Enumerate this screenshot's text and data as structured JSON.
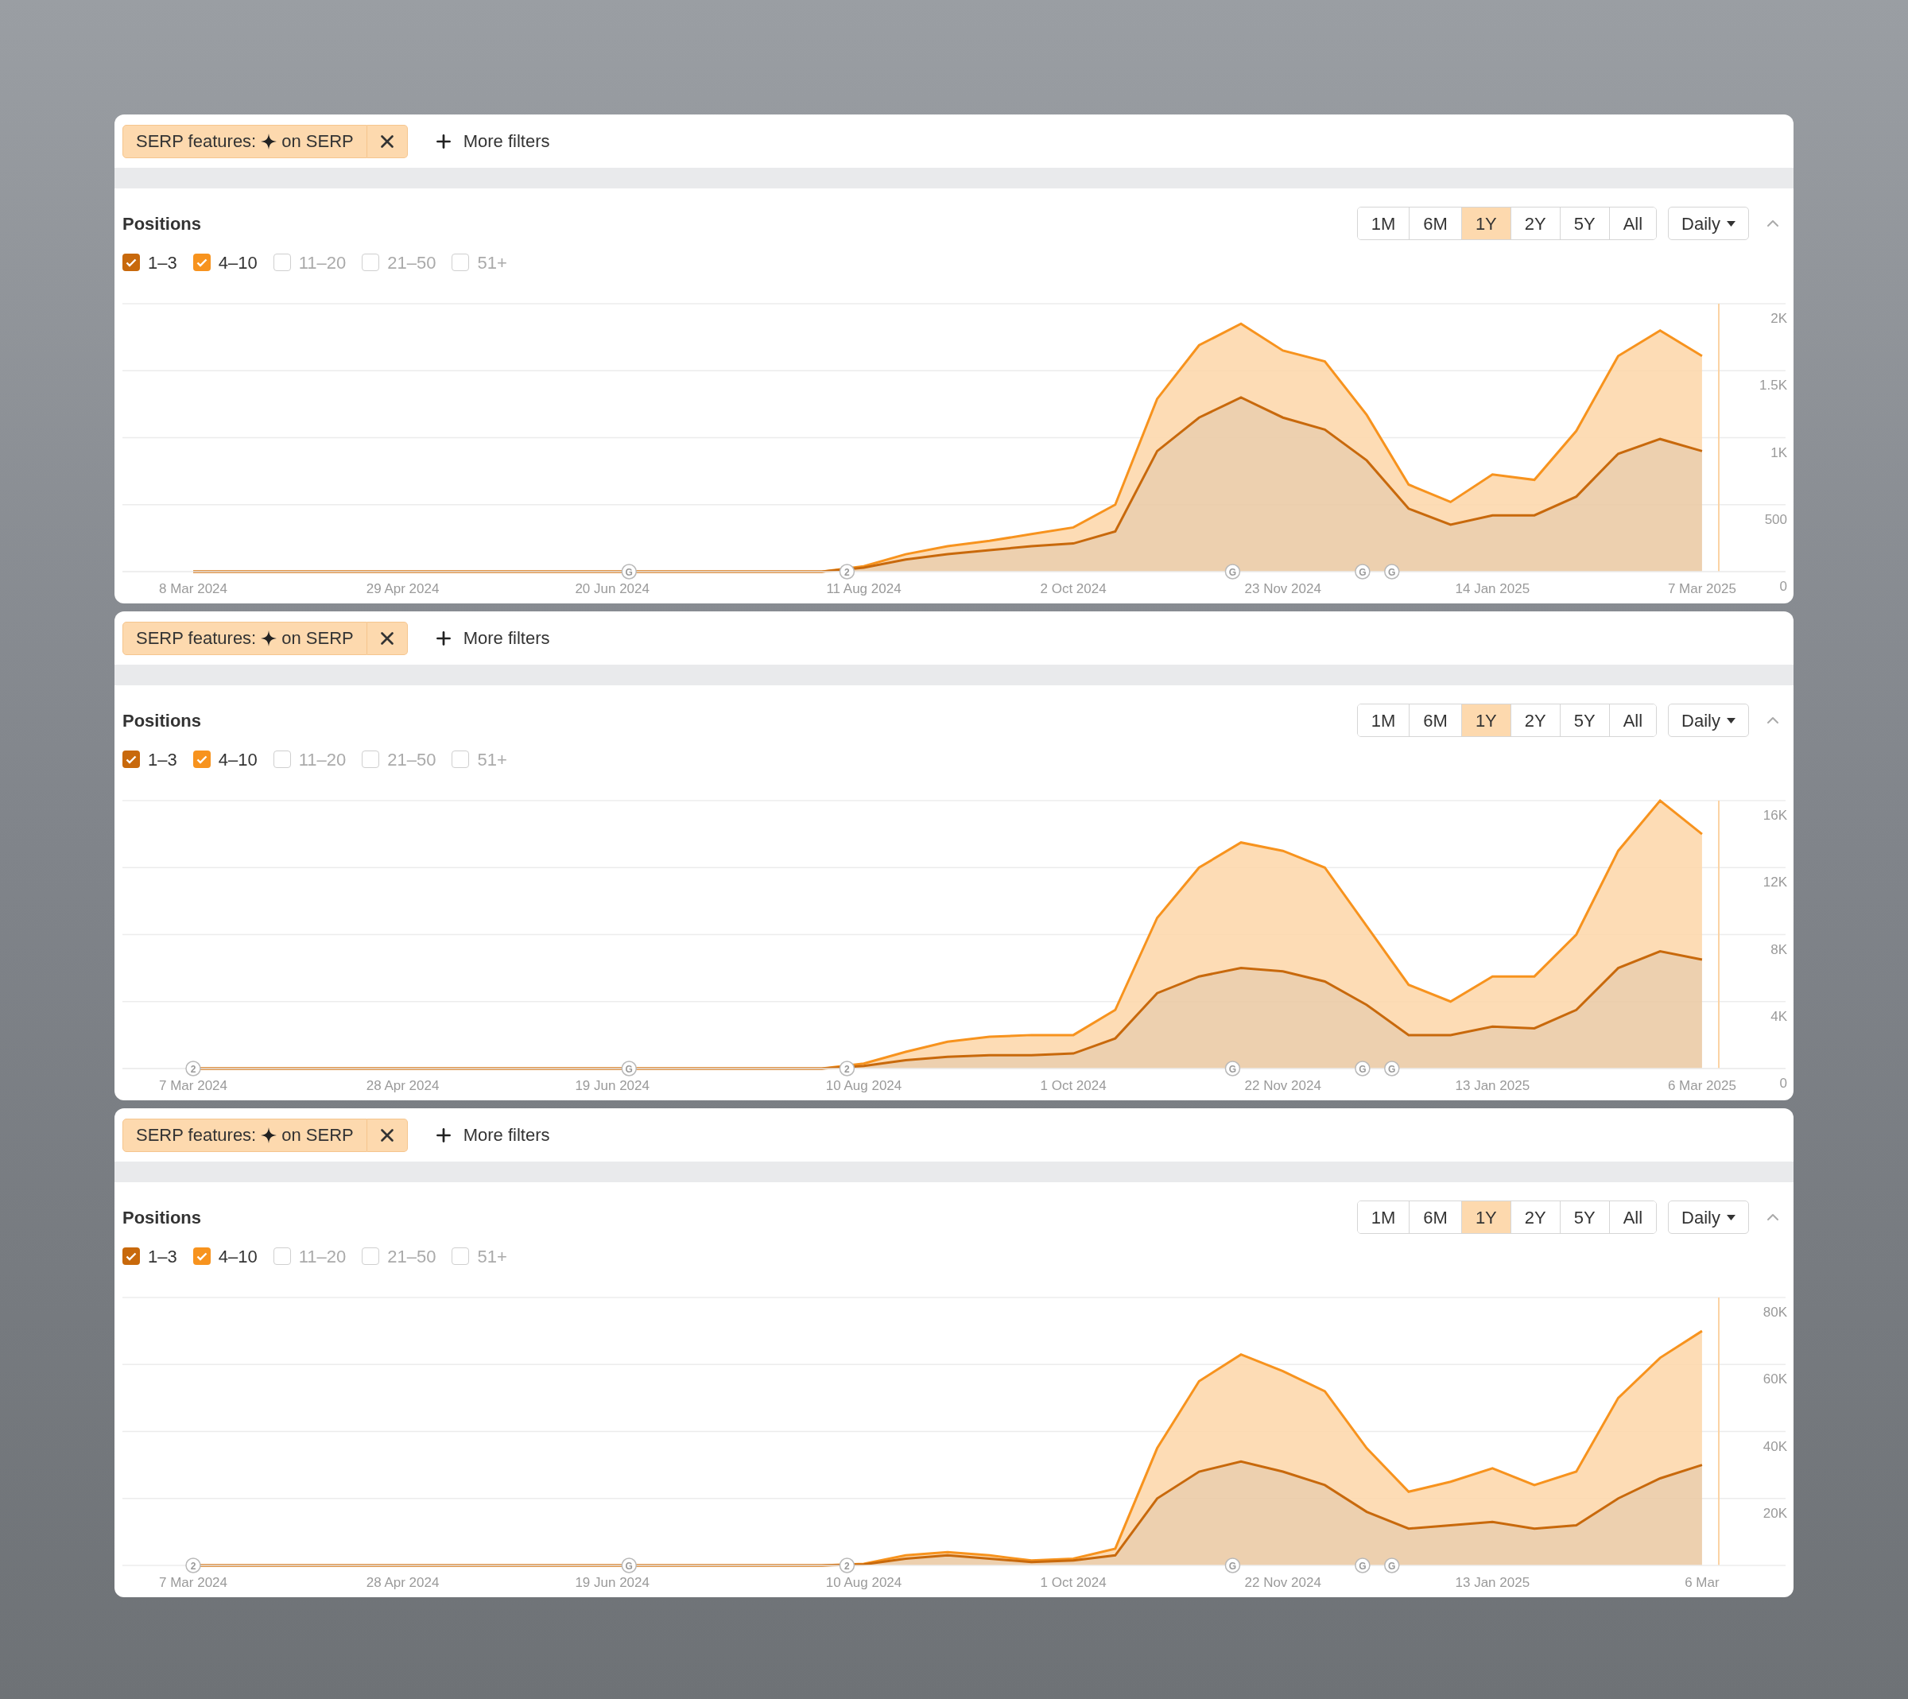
{
  "panels": [
    {
      "filter": {
        "text_before": "SERP features:",
        "text_after": "on SERP"
      },
      "more_filters": "More filters",
      "title": "Positions",
      "ranges": [
        {
          "label": "1M",
          "selected": false
        },
        {
          "label": "6M",
          "selected": false
        },
        {
          "label": "1Y",
          "selected": true
        },
        {
          "label": "2Y",
          "selected": false
        },
        {
          "label": "5Y",
          "selected": false
        },
        {
          "label": "All",
          "selected": false
        }
      ],
      "interval": "Daily",
      "checkboxes": [
        {
          "label": "1–3",
          "checked": true,
          "color": "#c8690c"
        },
        {
          "label": "4–10",
          "checked": true,
          "color": "#f7931e"
        },
        {
          "label": "11–20",
          "checked": false
        },
        {
          "label": "21–50",
          "checked": false
        },
        {
          "label": "51+",
          "checked": false
        }
      ],
      "chart_data": {
        "type": "area",
        "stacked": true,
        "grid": true,
        "categories": [
          "8 Mar 2024",
          null,
          null,
          null,
          null,
          "29 Apr 2024",
          null,
          null,
          null,
          null,
          "20 Jun 2024",
          null,
          null,
          null,
          null,
          null,
          "11 Aug 2024",
          null,
          null,
          null,
          null,
          "2 Oct 2024",
          null,
          null,
          null,
          null,
          "23 Nov 2024",
          null,
          null,
          null,
          null,
          "14 Jan 2025",
          null,
          null,
          null,
          null,
          "7 Mar 2025"
        ],
        "series": [
          {
            "color": "#c8690c",
            "values": [
              0,
              0,
              0,
              0,
              0,
              0,
              0,
              0,
              0,
              0,
              0,
              0,
              0,
              0,
              0,
              0,
              30,
              90,
              130,
              160,
              190,
              210,
              300,
              900,
              1150,
              1300,
              1150,
              1060,
              830,
              470,
              350,
              420,
              420,
              560,
              880,
              990,
              900
            ]
          },
          {
            "color": "#f7931e",
            "values": [
              0,
              0,
              0,
              0,
              0,
              0,
              0,
              0,
              0,
              0,
              0,
              0,
              0,
              0,
              0,
              0,
              10,
              40,
              60,
              70,
              90,
              120,
              200,
              390,
              540,
              550,
              500,
              510,
              340,
              180,
              170,
              305,
              265,
              490,
              730,
              810,
              710
            ]
          }
        ],
        "ylim": [
          0,
          2000
        ],
        "yticks": [
          {
            "value": 0,
            "label": "0"
          },
          {
            "value": 500,
            "label": "500"
          },
          {
            "value": 1000,
            "label": "1K"
          },
          {
            "value": 1500,
            "label": "1.5K"
          },
          {
            "value": 2000,
            "label": "2K"
          }
        ],
        "annotations": [
          {
            "text": "G"
          },
          {
            "text": "2"
          },
          {
            "text": "G"
          },
          {
            "text": "G"
          },
          {
            "text": "G"
          }
        ]
      }
    },
    {
      "filter": {
        "text_before": "SERP features:",
        "text_after": "on SERP"
      },
      "more_filters": "More filters",
      "title": "Positions",
      "ranges": [
        {
          "label": "1M",
          "selected": false
        },
        {
          "label": "6M",
          "selected": false
        },
        {
          "label": "1Y",
          "selected": true
        },
        {
          "label": "2Y",
          "selected": false
        },
        {
          "label": "5Y",
          "selected": false
        },
        {
          "label": "All",
          "selected": false
        }
      ],
      "interval": "Daily",
      "checkboxes": [
        {
          "label": "1–3",
          "checked": true,
          "color": "#c8690c"
        },
        {
          "label": "4–10",
          "checked": true,
          "color": "#f7931e"
        },
        {
          "label": "11–20",
          "checked": false
        },
        {
          "label": "21–50",
          "checked": false
        },
        {
          "label": "51+",
          "checked": false
        }
      ],
      "chart_data": {
        "type": "area",
        "stacked": true,
        "grid": true,
        "categories": [
          "7 Mar 2024",
          null,
          null,
          null,
          null,
          "28 Apr 2024",
          null,
          null,
          null,
          null,
          "19 Jun 2024",
          null,
          null,
          null,
          null,
          null,
          "10 Aug 2024",
          null,
          null,
          null,
          null,
          "1 Oct 2024",
          null,
          null,
          null,
          null,
          "22 Nov 2024",
          null,
          null,
          null,
          null,
          "13 Jan 2025",
          null,
          null,
          null,
          null,
          "6 Mar 2025"
        ],
        "series": [
          {
            "color": "#c8690c",
            "values": [
              0,
              0,
              0,
              0,
              0,
              0,
              0,
              0,
              0,
              0,
              0,
              0,
              0,
              0,
              0,
              0,
              150,
              500,
              700,
              800,
              800,
              900,
              1800,
              4500,
              5500,
              6000,
              5800,
              5200,
              3800,
              2000,
              2000,
              2500,
              2400,
              3500,
              6000,
              7000,
              6500
            ]
          },
          {
            "color": "#f7931e",
            "values": [
              0,
              0,
              0,
              0,
              0,
              0,
              0,
              0,
              0,
              0,
              0,
              0,
              0,
              0,
              0,
              0,
              150,
              500,
              900,
              1100,
              1200,
              1100,
              1700,
              4500,
              6500,
              7500,
              7200,
              6800,
              4700,
              3000,
              2000,
              3000,
              3100,
              4500,
              7000,
              9000,
              7500
            ]
          }
        ],
        "ylim": [
          0,
          16000
        ],
        "yticks": [
          {
            "value": 0,
            "label": "0"
          },
          {
            "value": 4000,
            "label": "4K"
          },
          {
            "value": 8000,
            "label": "8K"
          },
          {
            "value": 12000,
            "label": "12K"
          },
          {
            "value": 16000,
            "label": "16K"
          }
        ],
        "annotations": [
          {
            "text": "2"
          },
          {
            "text": "G"
          },
          {
            "text": "2"
          },
          {
            "text": "G"
          },
          {
            "text": "G"
          },
          {
            "text": "G"
          }
        ]
      }
    },
    {
      "filter": {
        "text_before": "SERP features:",
        "text_after": "on SERP"
      },
      "more_filters": "More filters",
      "title": "Positions",
      "ranges": [
        {
          "label": "1M",
          "selected": false
        },
        {
          "label": "6M",
          "selected": false
        },
        {
          "label": "1Y",
          "selected": true
        },
        {
          "label": "2Y",
          "selected": false
        },
        {
          "label": "5Y",
          "selected": false
        },
        {
          "label": "All",
          "selected": false
        }
      ],
      "interval": "Daily",
      "checkboxes": [
        {
          "label": "1–3",
          "checked": true,
          "color": "#c8690c"
        },
        {
          "label": "4–10",
          "checked": true,
          "color": "#f7931e"
        },
        {
          "label": "11–20",
          "checked": false
        },
        {
          "label": "21–50",
          "checked": false
        },
        {
          "label": "51+",
          "checked": false
        }
      ],
      "chart_data": {
        "type": "area",
        "stacked": true,
        "grid": true,
        "categories": [
          "7 Mar 2024",
          null,
          null,
          null,
          null,
          "28 Apr 2024",
          null,
          null,
          null,
          null,
          "19 Jun 2024",
          null,
          null,
          null,
          null,
          null,
          "10 Aug 2024",
          null,
          null,
          null,
          null,
          "1 Oct 2024",
          null,
          null,
          null,
          null,
          "22 Nov 2024",
          null,
          null,
          null,
          null,
          "13 Jan 2025",
          null,
          null,
          null,
          null,
          "6 Mar"
        ],
        "series": [
          {
            "color": "#c8690c",
            "values": [
              0,
              0,
              0,
              0,
              0,
              0,
              0,
              0,
              0,
              0,
              0,
              0,
              0,
              0,
              0,
              0,
              300,
              2000,
              3000,
              2000,
              1000,
              1500,
              3000,
              20000,
              28000,
              31000,
              28000,
              24000,
              16000,
              11000,
              12000,
              13000,
              11000,
              12000,
              20000,
              26000,
              30000
            ]
          },
          {
            "color": "#f7931e",
            "values": [
              0,
              0,
              0,
              0,
              0,
              0,
              0,
              0,
              0,
              0,
              0,
              0,
              0,
              0,
              0,
              0,
              200,
              1000,
              1000,
              1000,
              500,
              500,
              2000,
              15000,
              27000,
              32000,
              30000,
              28000,
              19000,
              11000,
              13000,
              16000,
              13000,
              16000,
              30000,
              36000,
              40000
            ]
          }
        ],
        "ylim": [
          0,
          80000
        ],
        "yticks": [
          {
            "value": 20000,
            "label": "20K"
          },
          {
            "value": 40000,
            "label": "40K"
          },
          {
            "value": 60000,
            "label": "60K"
          },
          {
            "value": 80000,
            "label": "80K"
          }
        ],
        "annotations": [
          {
            "text": "2"
          },
          {
            "text": "G"
          },
          {
            "text": "2"
          },
          {
            "text": "G"
          },
          {
            "text": "G"
          },
          {
            "text": "G"
          }
        ]
      }
    }
  ]
}
